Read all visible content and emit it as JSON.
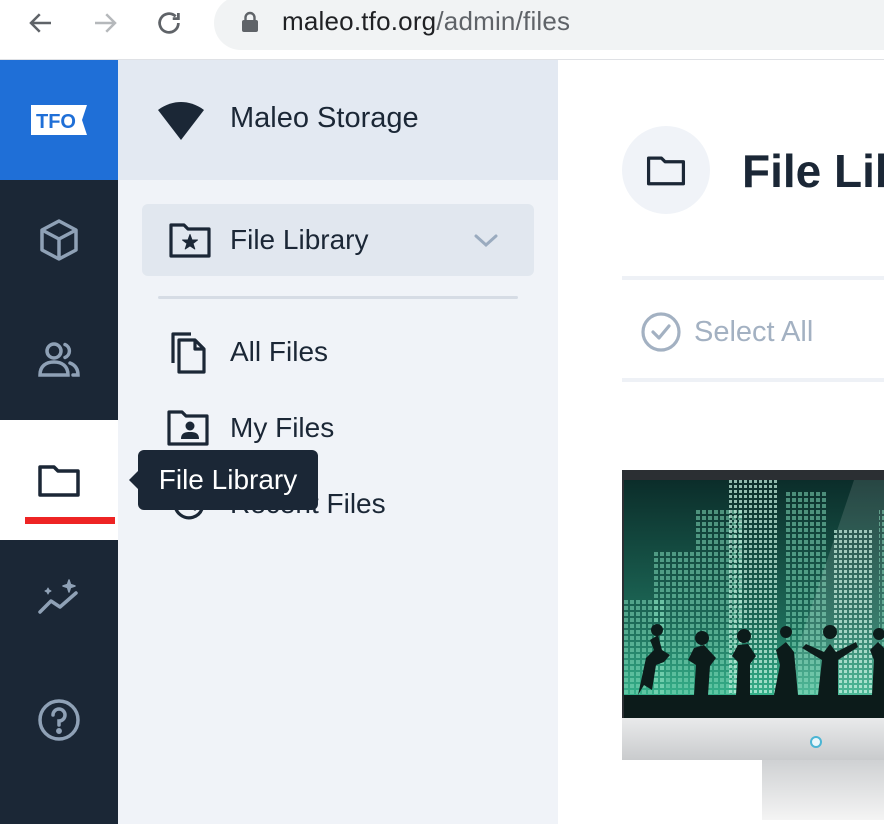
{
  "browser": {
    "url_host": "maleo.tfo.org",
    "url_path": "/admin/files"
  },
  "rail": {
    "logo_text": "TFO",
    "items": [
      {
        "name": "cube-icon"
      },
      {
        "name": "users-icon"
      },
      {
        "name": "folder-icon",
        "active": true
      },
      {
        "name": "analytics-icon"
      },
      {
        "name": "help-icon"
      }
    ],
    "accent_color": "#ee2424",
    "logo_bg": "#1f6fd7",
    "rail_bg": "#1b2736"
  },
  "tooltip": {
    "text": "File Library"
  },
  "panel": {
    "brand_name": "Maleo Storage",
    "section_label": "File Library",
    "items": [
      {
        "label": "All Files",
        "icon": "files-icon"
      },
      {
        "label": "My Files",
        "icon": "user-folder-icon"
      },
      {
        "label": "Recent Files",
        "icon": "history-icon"
      }
    ]
  },
  "main": {
    "title": "File Library",
    "select_all_label": "Select All"
  }
}
